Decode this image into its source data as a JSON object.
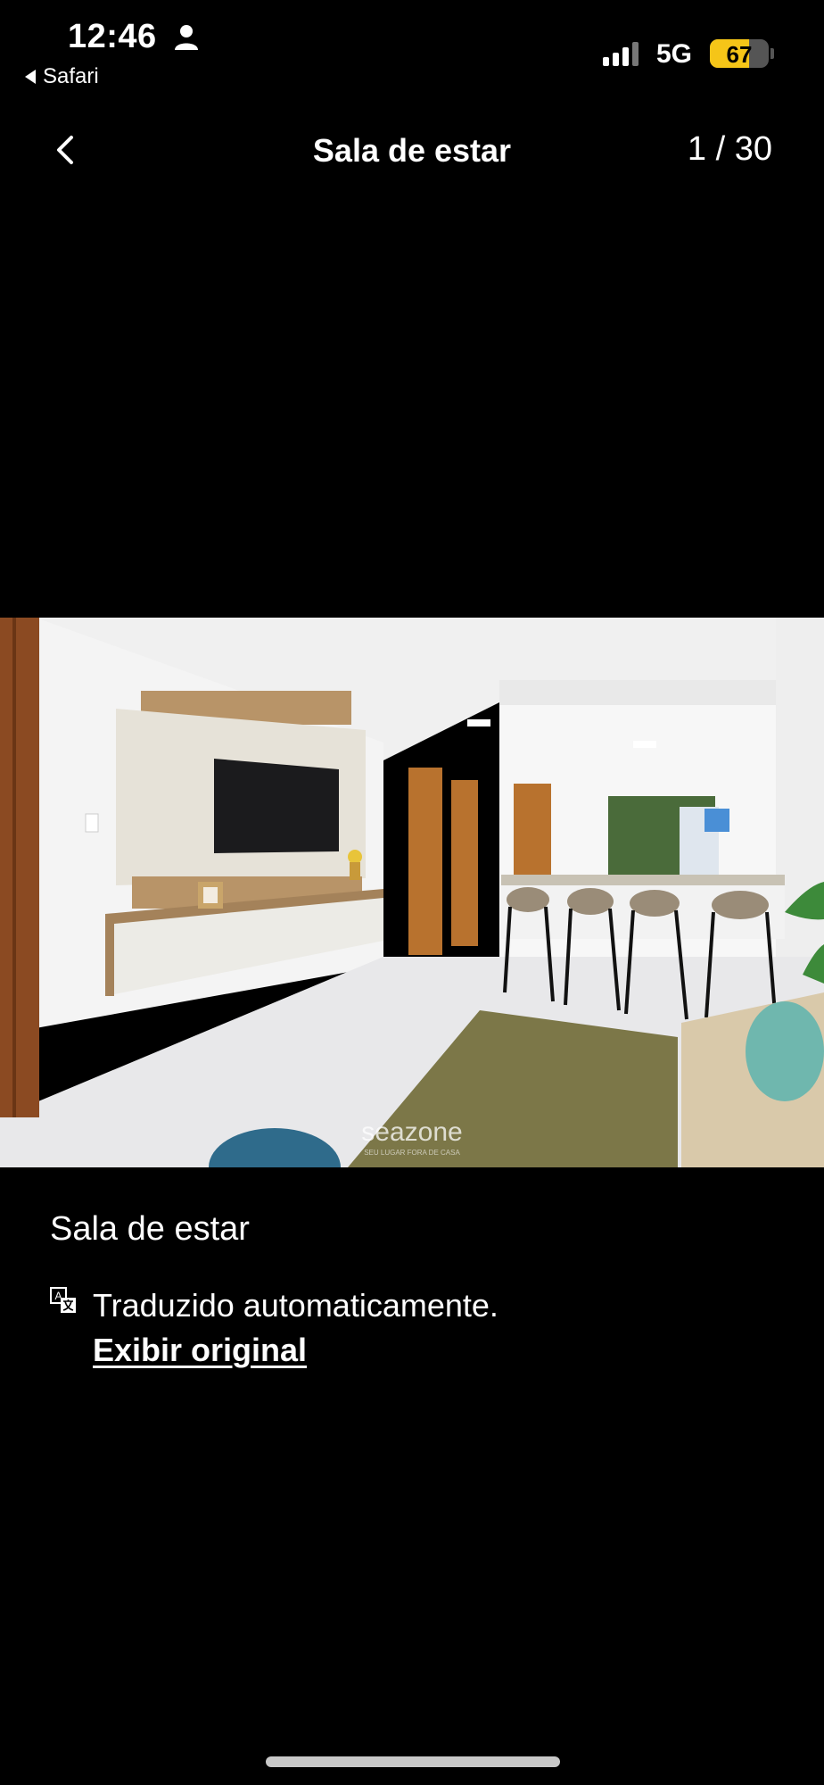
{
  "status_bar": {
    "time": "12:46",
    "back_app": "Safari",
    "network": "5G",
    "battery": 67,
    "battery_color": "#f5c518",
    "icons": [
      "person-icon",
      "signal-icon",
      "battery-icon"
    ]
  },
  "nav": {
    "title": "Sala de estar",
    "counter": "1 / 30",
    "back_icon": "chevron-left-icon"
  },
  "photo": {
    "watermark_brand": "seazone",
    "watermark_tagline": "SEU LUGAR FORA DE CASA"
  },
  "caption": {
    "title": "Sala de estar",
    "translated_text": "Traduzido automaticamente.",
    "show_original": "Exibir original",
    "translate_icon": "translate-icon"
  }
}
